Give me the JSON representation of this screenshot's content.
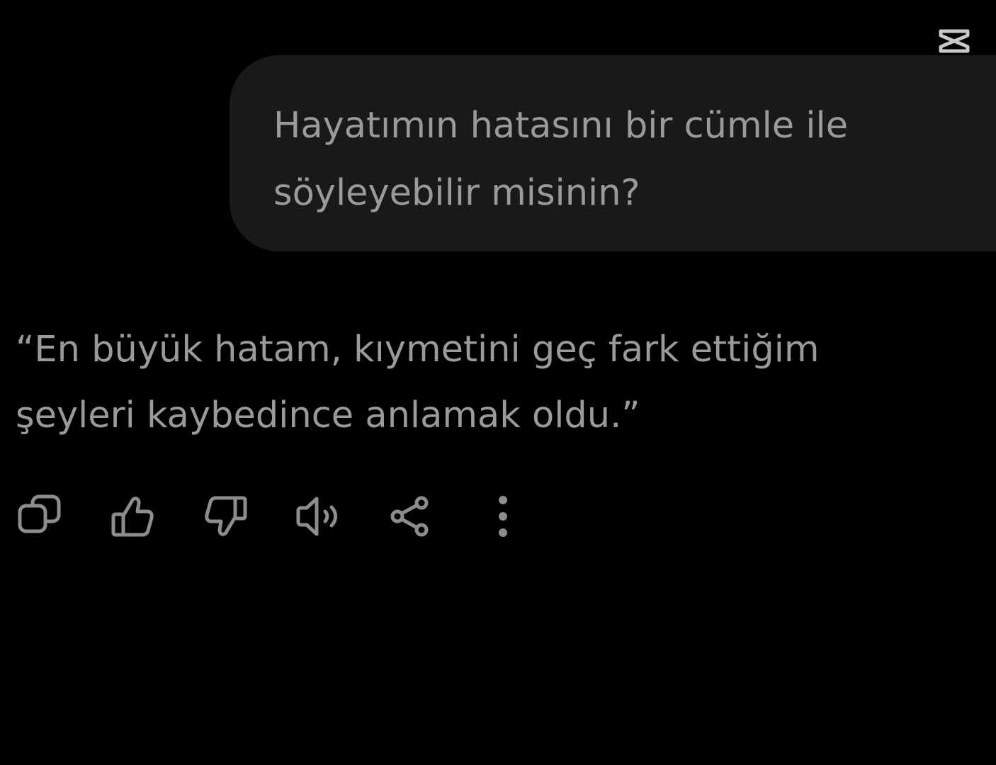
{
  "watermark": {
    "icon": "capcut-logo-icon"
  },
  "user_message": {
    "text": "Hayatımın hatasını  bir cümle ile\nsöyleyebilir misinin?"
  },
  "assistant_reply": {
    "text": "“En büyük hatam, kıymetini geç fark ettiğim\nşeyleri kaybedince anlamak oldu.”"
  },
  "action_bar": {
    "icons": [
      "copy-icon",
      "thumbs-up-icon",
      "thumbs-down-icon",
      "speaker-icon",
      "share-icon",
      "more-options-icon"
    ]
  },
  "colors": {
    "background": "#000000",
    "bubble": "#191919",
    "text": "#9a9a9a",
    "icon": "#8d8d8d"
  }
}
